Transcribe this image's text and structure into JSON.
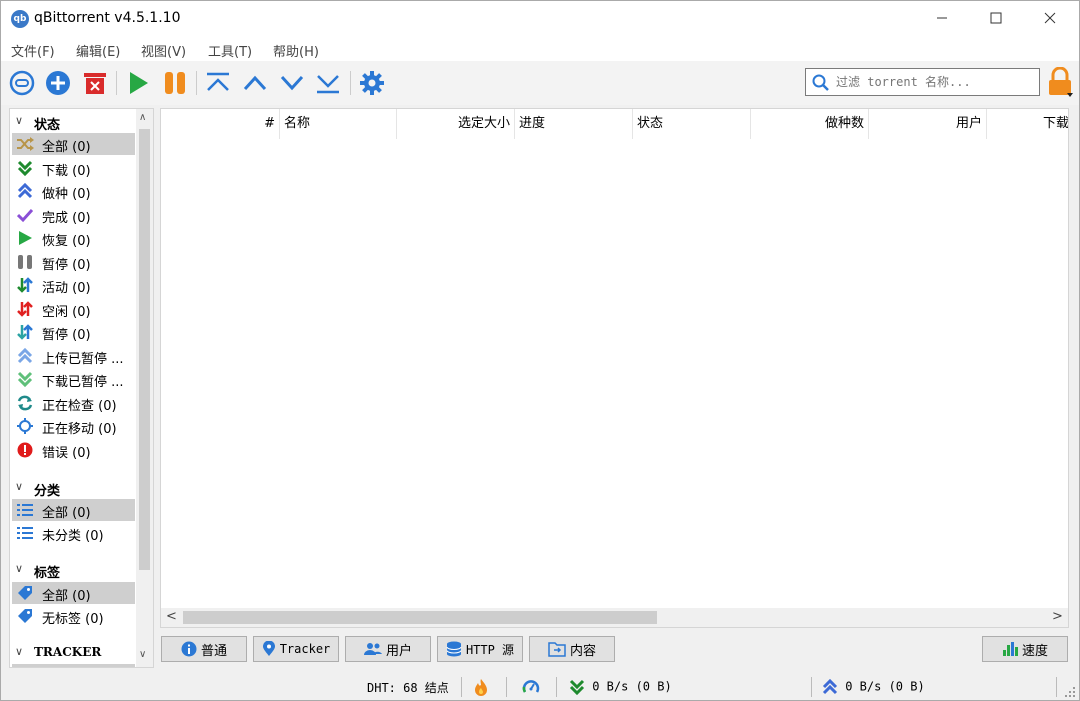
{
  "window": {
    "title": "qBittorrent v4.5.1.10",
    "app_icon_text": "qb"
  },
  "menu": [
    "文件(F)",
    "编辑(E)",
    "视图(V)",
    "工具(T)",
    "帮助(H)"
  ],
  "search": {
    "placeholder": "过滤 torrent 名称..."
  },
  "sidebar": {
    "status_header": "状态",
    "status_items": [
      {
        "label": "全部 (0)",
        "icon": "shuffle-icon",
        "selected": true
      },
      {
        "label": "下载 (0)",
        "icon": "download-icon"
      },
      {
        "label": "做种 (0)",
        "icon": "seeding-icon"
      },
      {
        "label": "完成 (0)",
        "icon": "check-icon"
      },
      {
        "label": "恢复 (0)",
        "icon": "play-icon"
      },
      {
        "label": "暂停 (0)",
        "icon": "pause-icon"
      },
      {
        "label": "活动 (0)",
        "icon": "active-arrows-icon"
      },
      {
        "label": "空闲 (0)",
        "icon": "idle-arrows-icon"
      },
      {
        "label": "暂停 (0)",
        "icon": "stalled-arrows-icon"
      },
      {
        "label": "上传已暂停 ...",
        "icon": "upload-stalled-icon"
      },
      {
        "label": "下载已暂停 ...",
        "icon": "download-stalled-icon"
      },
      {
        "label": "正在检查 (0)",
        "icon": "refresh-icon"
      },
      {
        "label": "正在移动 (0)",
        "icon": "moving-icon"
      },
      {
        "label": "错误 (0)",
        "icon": "error-icon"
      }
    ],
    "category_header": "分类",
    "category_items": [
      {
        "label": "全部 (0)",
        "selected": true
      },
      {
        "label": "未分类 (0)"
      }
    ],
    "tag_header": "标签",
    "tag_items": [
      {
        "label": "全部 (0)",
        "selected": true
      },
      {
        "label": "无标签 (0)"
      }
    ],
    "tracker_header": "TRACKER"
  },
  "table": {
    "columns": [
      "#",
      "名称",
      "选定大小",
      "进度",
      "状态",
      "做种数",
      "用户",
      "下载"
    ]
  },
  "tabs": [
    "普通",
    "Tracker",
    "用户",
    "HTTP 源",
    "内容"
  ],
  "speed_button": "速度",
  "statusbar": {
    "dht": "DHT: 68 结点",
    "download": "0 B/s (0 B)",
    "upload": "0 B/s (0 B)"
  },
  "colors": {
    "accent": "#2b78d4",
    "play": "#27a844",
    "pause": "#f08c1e",
    "delete": "#d92b2b"
  }
}
